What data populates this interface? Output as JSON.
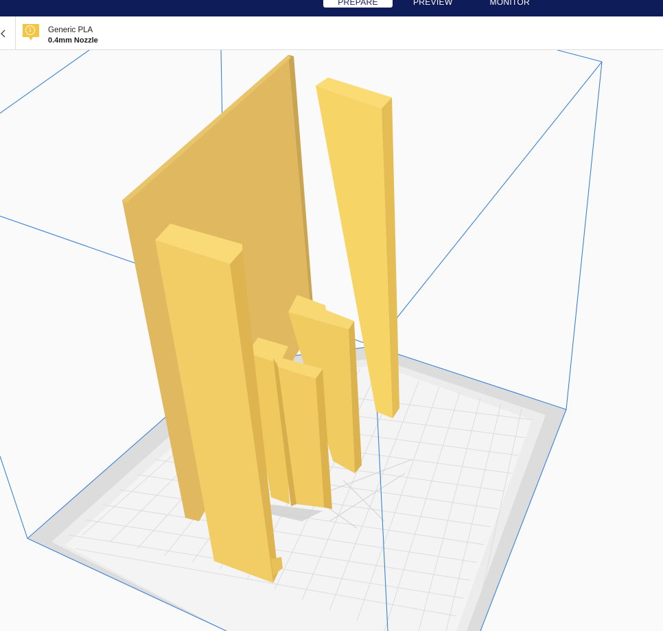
{
  "header": {
    "stages": [
      {
        "label": "PREPARE",
        "active": true
      },
      {
        "label": "PREVIEW",
        "active": false
      },
      {
        "label": "MONITOR",
        "active": false
      }
    ],
    "bar_color": "#0f1c5a"
  },
  "toolbar": {
    "back_icon": "chevron-left-icon",
    "extruder": {
      "number": "1",
      "material": "Generic PLA",
      "nozzle": "0.4mm Nozzle",
      "color": "#f5c542"
    }
  },
  "viewport": {
    "model_color": "#f2cd6b",
    "build_volume_outline_color": "#3a82d6",
    "build_plate_color": "#f2f2f2"
  }
}
